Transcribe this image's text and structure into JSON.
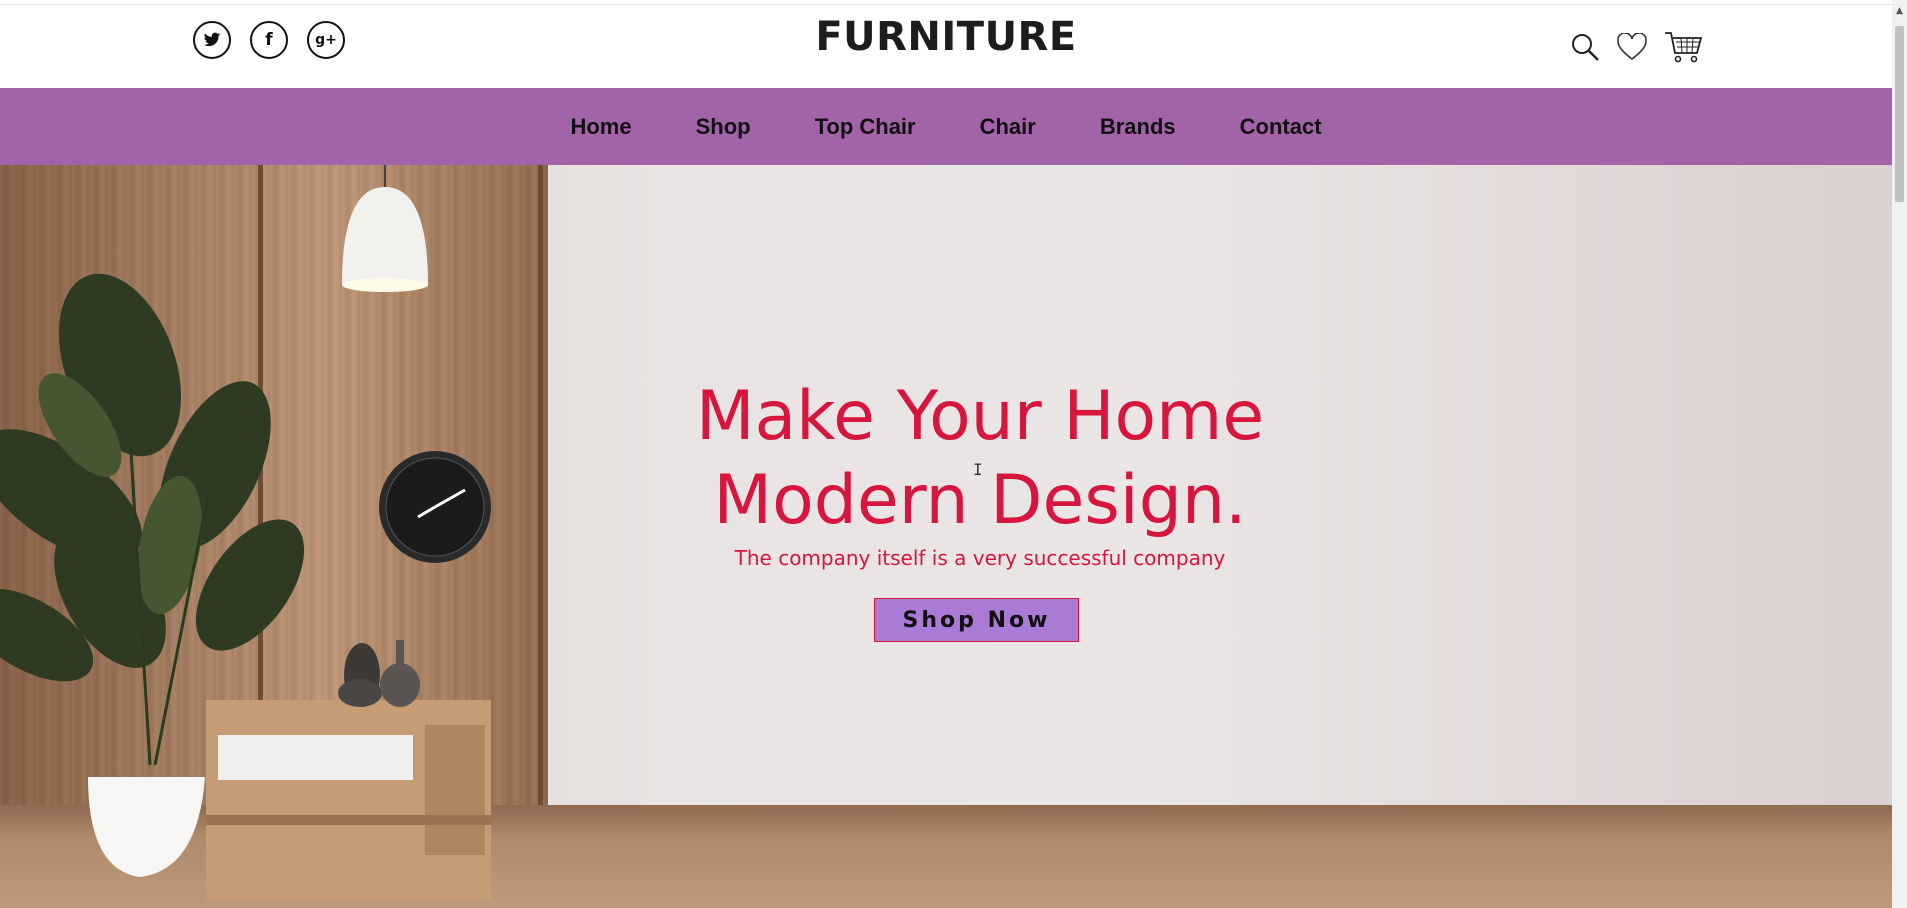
{
  "header": {
    "brand": "FURNITURE",
    "social": [
      {
        "name": "twitter-icon",
        "glyph": "🐦"
      },
      {
        "name": "facebook-icon",
        "glyph": "f"
      },
      {
        "name": "google-plus-icon",
        "glyph": "g+"
      }
    ],
    "icons": [
      "search-icon",
      "heart-icon",
      "cart-icon"
    ]
  },
  "nav": {
    "items": [
      "Home",
      "Shop",
      "Top Chair",
      "Chair",
      "Brands",
      "Contact"
    ]
  },
  "hero": {
    "headline_line1": "Make Your Home",
    "headline_line2": "Modern Design.",
    "subtitle": "The company itself is a very successful company",
    "cta_label": "Shop Now"
  },
  "colors": {
    "nav_bg": "#a363a8",
    "accent": "#d6163d",
    "cta_bg": "#a97bd6"
  }
}
